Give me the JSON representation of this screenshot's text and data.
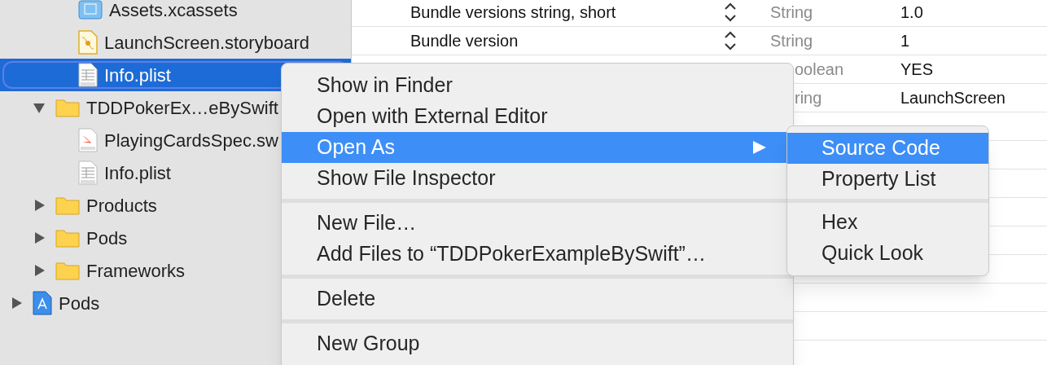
{
  "navigator": {
    "tree": [
      {
        "children": [
          {
            "children": [
              {
                "label": "Assets.xcassets",
                "kind": "assets",
                "selected": false
              },
              {
                "label": "LaunchScreen.storyboard",
                "kind": "storyboard",
                "selected": false
              },
              {
                "label": "Info.plist",
                "kind": "plist",
                "selected": true
              }
            ]
          },
          {
            "label": "TDDPokerEx…eBySwift",
            "kind": "folder",
            "expanded": true,
            "selected": false,
            "children": [
              {
                "label": "PlayingCardsSpec.sw",
                "kind": "swift",
                "selected": false
              },
              {
                "label": "Info.plist",
                "kind": "plist",
                "selected": false
              }
            ]
          },
          {
            "label": "Products",
            "kind": "folder",
            "expanded": false,
            "selected": false
          },
          {
            "label": "Pods",
            "kind": "folder",
            "expanded": false,
            "selected": false
          },
          {
            "label": "Frameworks",
            "kind": "folder",
            "expanded": false,
            "selected": false
          }
        ]
      },
      {
        "label": "Pods",
        "kind": "project",
        "expanded": false,
        "selected": false
      }
    ]
  },
  "plist": {
    "rows": [
      {
        "key": "Bundle versions string, short",
        "type": "String",
        "value": "1.0",
        "covered": false
      },
      {
        "key": "Bundle version",
        "type": "String",
        "value": "1",
        "covered": false
      },
      {
        "type": "oolean",
        "value": "YES",
        "covered": true
      },
      {
        "type": "ring",
        "value": "LaunchScreen",
        "covered": true
      }
    ]
  },
  "context_menu": {
    "sections": [
      [
        {
          "label": "Show in Finder",
          "selected": false,
          "submenu": false
        },
        {
          "label": "Open with External Editor",
          "selected": false,
          "submenu": false
        },
        {
          "label": "Open As",
          "selected": true,
          "submenu": true
        },
        {
          "label": "Show File Inspector",
          "selected": false,
          "submenu": false
        }
      ],
      [
        {
          "label": "New File…",
          "selected": false,
          "submenu": false
        },
        {
          "label": "Add Files to “TDDPokerExampleBySwift”…",
          "selected": false,
          "submenu": false
        }
      ],
      [
        {
          "label": "Delete",
          "selected": false,
          "submenu": false
        }
      ],
      [
        {
          "label": "New Group",
          "selected": false,
          "submenu": false
        }
      ]
    ]
  },
  "submenu": {
    "sections": [
      [
        {
          "label": "Source Code",
          "selected": true
        },
        {
          "label": "Property List",
          "selected": false
        }
      ],
      [
        {
          "label": "Hex",
          "selected": false
        },
        {
          "label": "Quick Look",
          "selected": false
        }
      ]
    ]
  }
}
